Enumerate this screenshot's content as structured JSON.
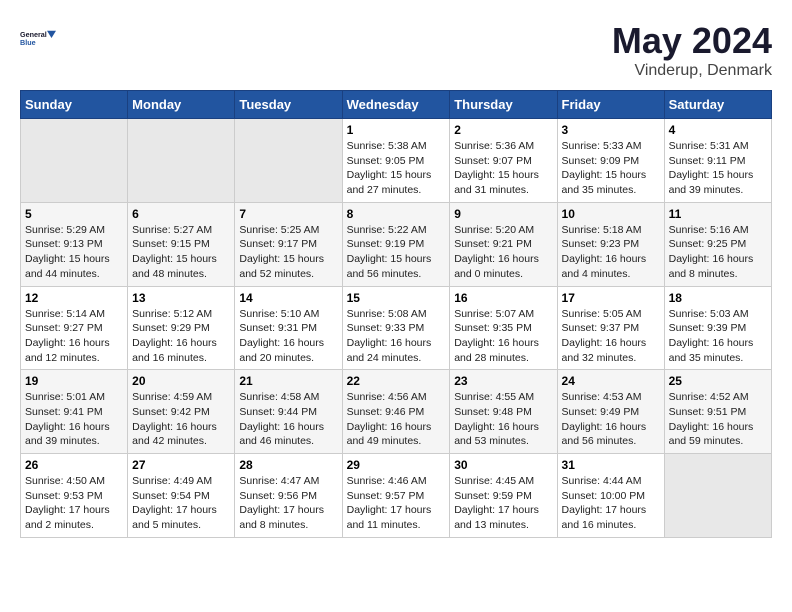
{
  "header": {
    "logo_line1": "General",
    "logo_line2": "Blue",
    "month": "May 2024",
    "location": "Vinderup, Denmark"
  },
  "weekdays": [
    "Sunday",
    "Monday",
    "Tuesday",
    "Wednesday",
    "Thursday",
    "Friday",
    "Saturday"
  ],
  "weeks": [
    [
      {
        "day": "",
        "info": ""
      },
      {
        "day": "",
        "info": ""
      },
      {
        "day": "",
        "info": ""
      },
      {
        "day": "1",
        "info": "Sunrise: 5:38 AM\nSunset: 9:05 PM\nDaylight: 15 hours\nand 27 minutes."
      },
      {
        "day": "2",
        "info": "Sunrise: 5:36 AM\nSunset: 9:07 PM\nDaylight: 15 hours\nand 31 minutes."
      },
      {
        "day": "3",
        "info": "Sunrise: 5:33 AM\nSunset: 9:09 PM\nDaylight: 15 hours\nand 35 minutes."
      },
      {
        "day": "4",
        "info": "Sunrise: 5:31 AM\nSunset: 9:11 PM\nDaylight: 15 hours\nand 39 minutes."
      }
    ],
    [
      {
        "day": "5",
        "info": "Sunrise: 5:29 AM\nSunset: 9:13 PM\nDaylight: 15 hours\nand 44 minutes."
      },
      {
        "day": "6",
        "info": "Sunrise: 5:27 AM\nSunset: 9:15 PM\nDaylight: 15 hours\nand 48 minutes."
      },
      {
        "day": "7",
        "info": "Sunrise: 5:25 AM\nSunset: 9:17 PM\nDaylight: 15 hours\nand 52 minutes."
      },
      {
        "day": "8",
        "info": "Sunrise: 5:22 AM\nSunset: 9:19 PM\nDaylight: 15 hours\nand 56 minutes."
      },
      {
        "day": "9",
        "info": "Sunrise: 5:20 AM\nSunset: 9:21 PM\nDaylight: 16 hours\nand 0 minutes."
      },
      {
        "day": "10",
        "info": "Sunrise: 5:18 AM\nSunset: 9:23 PM\nDaylight: 16 hours\nand 4 minutes."
      },
      {
        "day": "11",
        "info": "Sunrise: 5:16 AM\nSunset: 9:25 PM\nDaylight: 16 hours\nand 8 minutes."
      }
    ],
    [
      {
        "day": "12",
        "info": "Sunrise: 5:14 AM\nSunset: 9:27 PM\nDaylight: 16 hours\nand 12 minutes."
      },
      {
        "day": "13",
        "info": "Sunrise: 5:12 AM\nSunset: 9:29 PM\nDaylight: 16 hours\nand 16 minutes."
      },
      {
        "day": "14",
        "info": "Sunrise: 5:10 AM\nSunset: 9:31 PM\nDaylight: 16 hours\nand 20 minutes."
      },
      {
        "day": "15",
        "info": "Sunrise: 5:08 AM\nSunset: 9:33 PM\nDaylight: 16 hours\nand 24 minutes."
      },
      {
        "day": "16",
        "info": "Sunrise: 5:07 AM\nSunset: 9:35 PM\nDaylight: 16 hours\nand 28 minutes."
      },
      {
        "day": "17",
        "info": "Sunrise: 5:05 AM\nSunset: 9:37 PM\nDaylight: 16 hours\nand 32 minutes."
      },
      {
        "day": "18",
        "info": "Sunrise: 5:03 AM\nSunset: 9:39 PM\nDaylight: 16 hours\nand 35 minutes."
      }
    ],
    [
      {
        "day": "19",
        "info": "Sunrise: 5:01 AM\nSunset: 9:41 PM\nDaylight: 16 hours\nand 39 minutes."
      },
      {
        "day": "20",
        "info": "Sunrise: 4:59 AM\nSunset: 9:42 PM\nDaylight: 16 hours\nand 42 minutes."
      },
      {
        "day": "21",
        "info": "Sunrise: 4:58 AM\nSunset: 9:44 PM\nDaylight: 16 hours\nand 46 minutes."
      },
      {
        "day": "22",
        "info": "Sunrise: 4:56 AM\nSunset: 9:46 PM\nDaylight: 16 hours\nand 49 minutes."
      },
      {
        "day": "23",
        "info": "Sunrise: 4:55 AM\nSunset: 9:48 PM\nDaylight: 16 hours\nand 53 minutes."
      },
      {
        "day": "24",
        "info": "Sunrise: 4:53 AM\nSunset: 9:49 PM\nDaylight: 16 hours\nand 56 minutes."
      },
      {
        "day": "25",
        "info": "Sunrise: 4:52 AM\nSunset: 9:51 PM\nDaylight: 16 hours\nand 59 minutes."
      }
    ],
    [
      {
        "day": "26",
        "info": "Sunrise: 4:50 AM\nSunset: 9:53 PM\nDaylight: 17 hours\nand 2 minutes."
      },
      {
        "day": "27",
        "info": "Sunrise: 4:49 AM\nSunset: 9:54 PM\nDaylight: 17 hours\nand 5 minutes."
      },
      {
        "day": "28",
        "info": "Sunrise: 4:47 AM\nSunset: 9:56 PM\nDaylight: 17 hours\nand 8 minutes."
      },
      {
        "day": "29",
        "info": "Sunrise: 4:46 AM\nSunset: 9:57 PM\nDaylight: 17 hours\nand 11 minutes."
      },
      {
        "day": "30",
        "info": "Sunrise: 4:45 AM\nSunset: 9:59 PM\nDaylight: 17 hours\nand 13 minutes."
      },
      {
        "day": "31",
        "info": "Sunrise: 4:44 AM\nSunset: 10:00 PM\nDaylight: 17 hours\nand 16 minutes."
      },
      {
        "day": "",
        "info": ""
      }
    ]
  ]
}
